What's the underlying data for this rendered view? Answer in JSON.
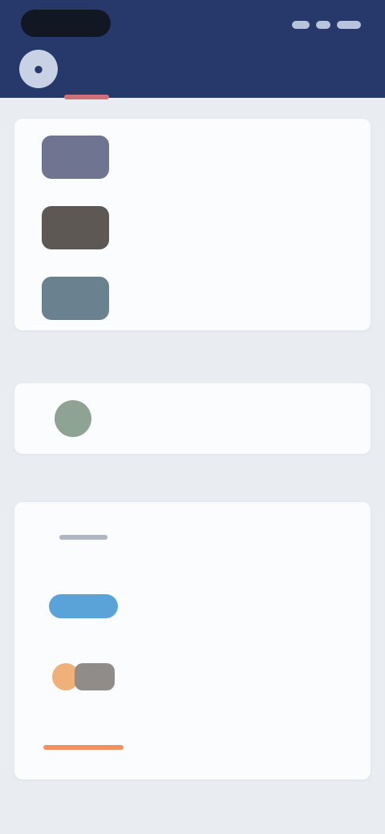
{
  "header": {
    "title": "",
    "avatar_icon": "user-icon",
    "status_icons": [
      "signal-icon",
      "wifi-icon",
      "battery-icon"
    ]
  },
  "sections": [
    {
      "label": "",
      "items": [
        {
          "title": "",
          "subtitle": "",
          "thumb_color": "#6f7590"
        },
        {
          "title": "",
          "subtitle": "",
          "thumb_color": "#5e5854"
        },
        {
          "title": "",
          "subtitle": "",
          "thumb_color": "#6a8290"
        }
      ]
    },
    {
      "label": "",
      "items": [
        {
          "title": "",
          "subtitle": "",
          "thumb_color": "#8ea394"
        }
      ]
    },
    {
      "label": "",
      "items": [
        {
          "title": "",
          "subtitle": "",
          "logo_colors": [
            "#aeb6c2"
          ]
        },
        {
          "title": "",
          "subtitle": "",
          "logo_colors": [
            "#5aa3d8"
          ]
        },
        {
          "title": "",
          "subtitle": "",
          "logo_colors": [
            "#f0b07a",
            "#8f8c8a"
          ]
        },
        {
          "title": "",
          "subtitle": "",
          "logo_colors": [
            "#f09060"
          ]
        }
      ]
    }
  ],
  "colors": {
    "header_bg": "#26396a",
    "page_bg": "#e9edf2",
    "card_bg": "#fbfcfd",
    "accent": "#cf6f7a"
  }
}
